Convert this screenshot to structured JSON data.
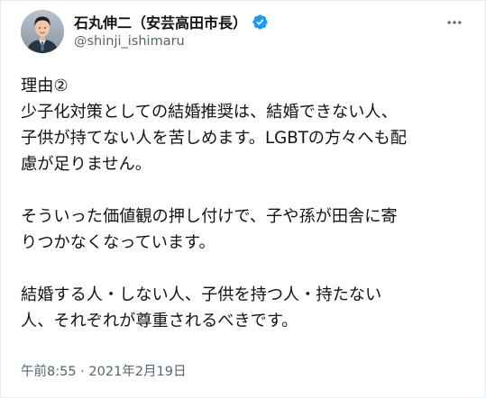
{
  "user": {
    "display_name": "石丸伸二（安芸高田市長）",
    "handle": "@shinji_ishimaru",
    "verified": true,
    "avatar_icon": "user-avatar-photo"
  },
  "icons": {
    "verified": "verified-badge-icon",
    "more": "more-horizontal-icon"
  },
  "colors": {
    "verified_blue": "#1d9bf0",
    "secondary_text": "#536471",
    "primary_text": "#0f1419"
  },
  "tweet": {
    "lines": [
      "理由②",
      "少子化対策としての結婚推奨は、結婚できない人、",
      "子供が持てない人を苦しめます。LGBTの方々へも配",
      "慮が足りません。",
      "",
      "そういった価値観の押し付けで、子や孫が田舎に寄",
      "りつかなくなっています。",
      "",
      "結婚する人・しない人、子供を持つ人・持たない",
      "人、それぞれが尊重されるべきです。"
    ],
    "timestamp": "午前8:55 · 2021年2月19日"
  }
}
